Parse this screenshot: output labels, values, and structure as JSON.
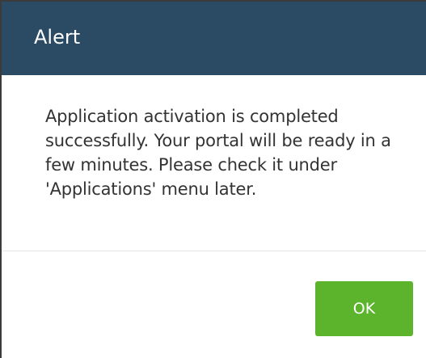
{
  "dialog": {
    "title": "Alert",
    "message": "Application activation is completed successfully. Your portal will be ready in a few minutes. Please check it under 'Applications' menu later.",
    "ok_label": "OK"
  },
  "colors": {
    "header_bg": "#2b4a63",
    "ok_button_bg": "#5cb42c"
  }
}
